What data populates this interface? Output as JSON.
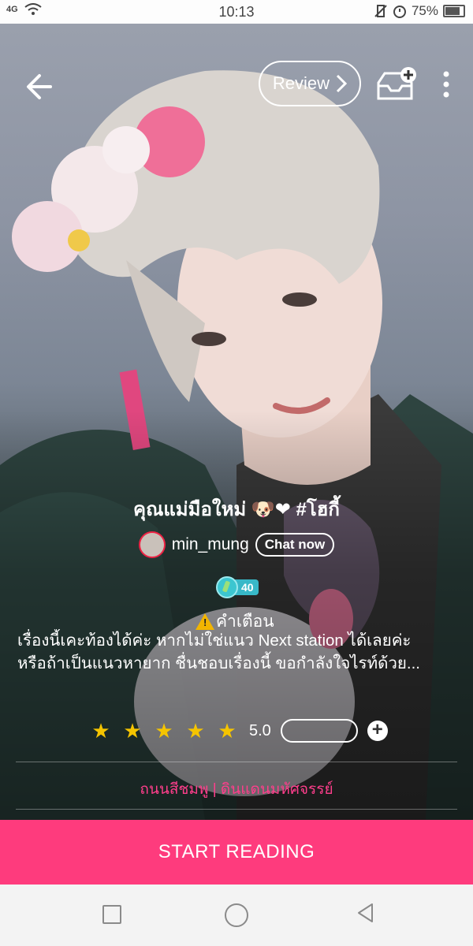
{
  "status_bar": {
    "network": "4G",
    "time": "10:13",
    "battery": "75%"
  },
  "header": {
    "review_label": "Review",
    "icons": [
      "back-arrow-icon",
      "add-to-library-icon",
      "more-vertical-icon"
    ]
  },
  "story": {
    "title": "คุณแม่มือใหม่ 🐶❤ #โฮกี้",
    "author": "min_mung",
    "chat_label": "Chat now",
    "level": "40",
    "warning_label": "คำเตือน",
    "synopsis_line1": "เรื่องนี้เคะท้องได้ค่ะ หากไม่ใช่แนว Next station ได้เลยค่ะ",
    "synopsis_line2": "หรือถ้าเป็นแนวหายาก ชื่นชอบเรื่องนี้ ขอกำลังใจไรท์ด้วย...",
    "rating_score": "5.0",
    "stars": 5,
    "tags": "ถนนสีชมพู | ดินแดนมหัศจรรย์"
  },
  "cta": {
    "start_label": "START READING"
  },
  "colors": {
    "accent": "#fe3b7d",
    "tag_color": "#ff3e8c",
    "star_color": "#f5c400"
  }
}
